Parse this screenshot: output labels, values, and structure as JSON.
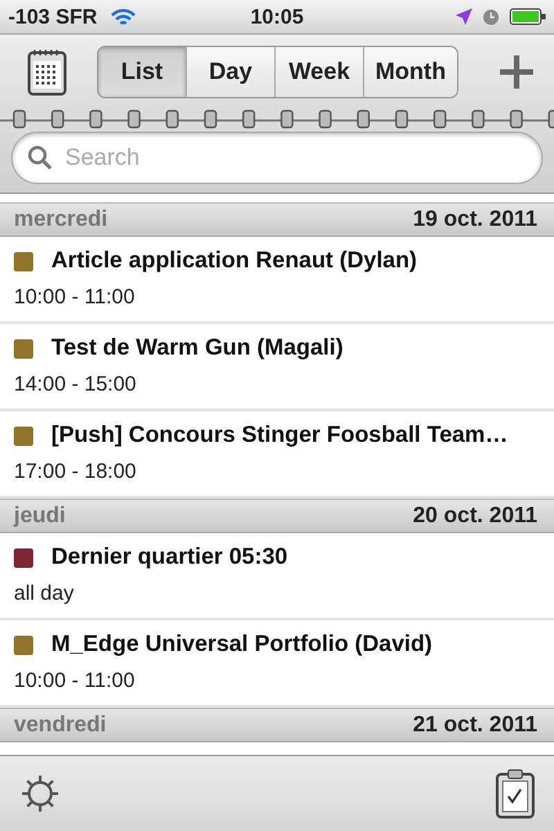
{
  "status_bar": {
    "carrier": "-103 SFR",
    "time": "10:05"
  },
  "toolbar": {
    "tabs": [
      {
        "label": "List",
        "selected": true
      },
      {
        "label": "Day",
        "selected": false
      },
      {
        "label": "Week",
        "selected": false
      },
      {
        "label": "Month",
        "selected": false
      }
    ]
  },
  "search": {
    "placeholder": "Search"
  },
  "days": [
    {
      "weekday": "mercredi",
      "date": "19 oct. 2011",
      "events": [
        {
          "title": "Article application Renaut (Dylan)",
          "time": "10:00 - 11:00",
          "color": "#8f7429"
        },
        {
          "title": "Test de Warm Gun (Magali)",
          "time": "14:00 - 15:00",
          "color": "#8f7429"
        },
        {
          "title": "[Push] Concours Stinger Foosball Team…",
          "time": "17:00 - 18:00",
          "color": "#8f7429"
        }
      ]
    },
    {
      "weekday": "jeudi",
      "date": "20 oct. 2011",
      "events": [
        {
          "title": "Dernier quartier 05:30",
          "time": "all day",
          "color": "#7e2634"
        },
        {
          "title": "M_Edge Universal Portfolio (David)",
          "time": "10:00 - 11:00",
          "color": "#8f7429"
        }
      ]
    },
    {
      "weekday": "vendredi",
      "date": "21 oct. 2011"
    }
  ]
}
